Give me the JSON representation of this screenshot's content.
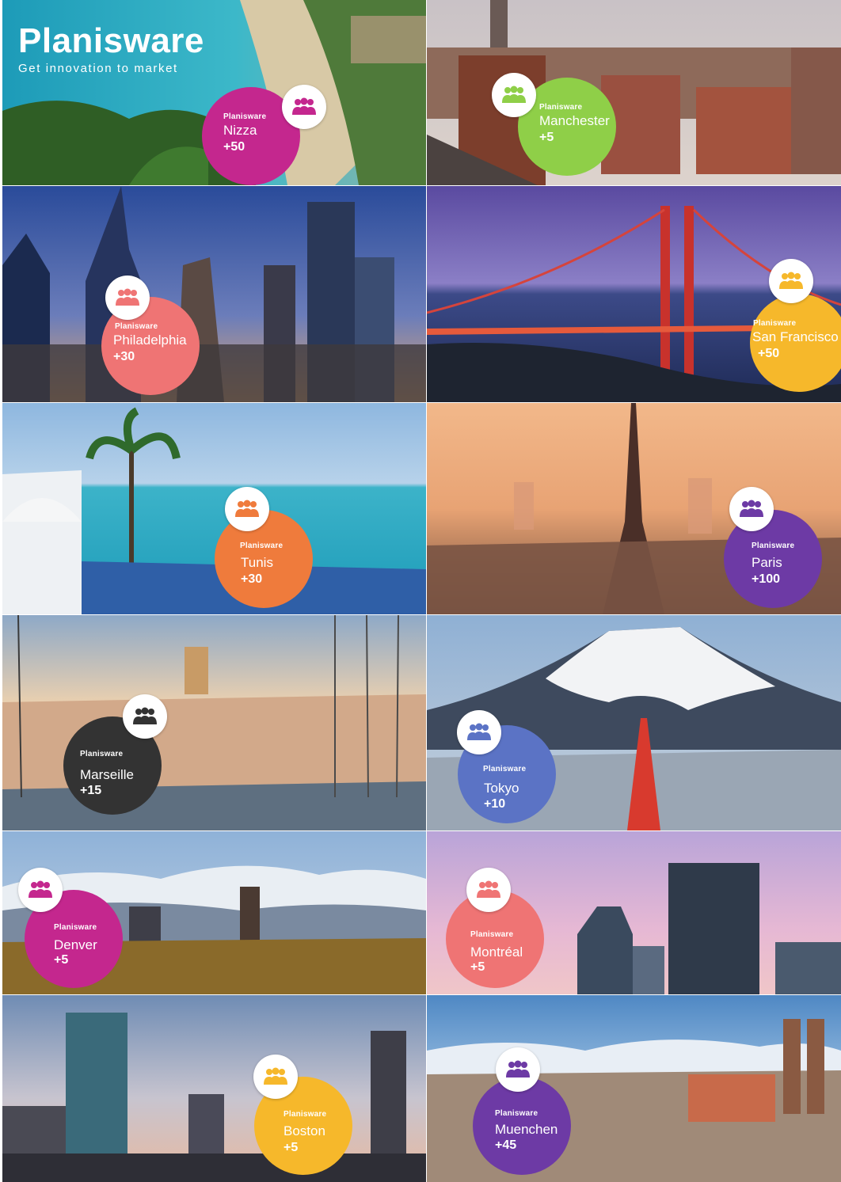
{
  "logo": {
    "name": "Planisware",
    "tagline": "Get innovation to market"
  },
  "brand_label": "Planisware",
  "icon": "people-group-icon",
  "offices": [
    {
      "city": "Nizza",
      "count": "+50",
      "color": "#c4278e"
    },
    {
      "city": "Manchester",
      "count": "+5",
      "color": "#8fcf48"
    },
    {
      "city": "Philadelphia",
      "count": "+30",
      "color": "#ef7474"
    },
    {
      "city": "San Francisco",
      "count": "+50",
      "color": "#f6b82b"
    },
    {
      "city": "Tunis",
      "count": "+30",
      "color": "#ef7b3c"
    },
    {
      "city": "Paris",
      "count": "+100",
      "color": "#6d3aa5"
    },
    {
      "city": "Marseille",
      "count": "+15",
      "color": "#333333"
    },
    {
      "city": "Tokyo",
      "count": "+10",
      "color": "#5b73c5"
    },
    {
      "city": "Denver",
      "count": "+5",
      "color": "#c4278e"
    },
    {
      "city": "Montréal",
      "count": "+5",
      "color": "#ef7474"
    },
    {
      "city": "Boston",
      "count": "+5",
      "color": "#f6b82b"
    },
    {
      "city": "Muenchen",
      "count": "+45",
      "color": "#6d3aa5"
    }
  ]
}
